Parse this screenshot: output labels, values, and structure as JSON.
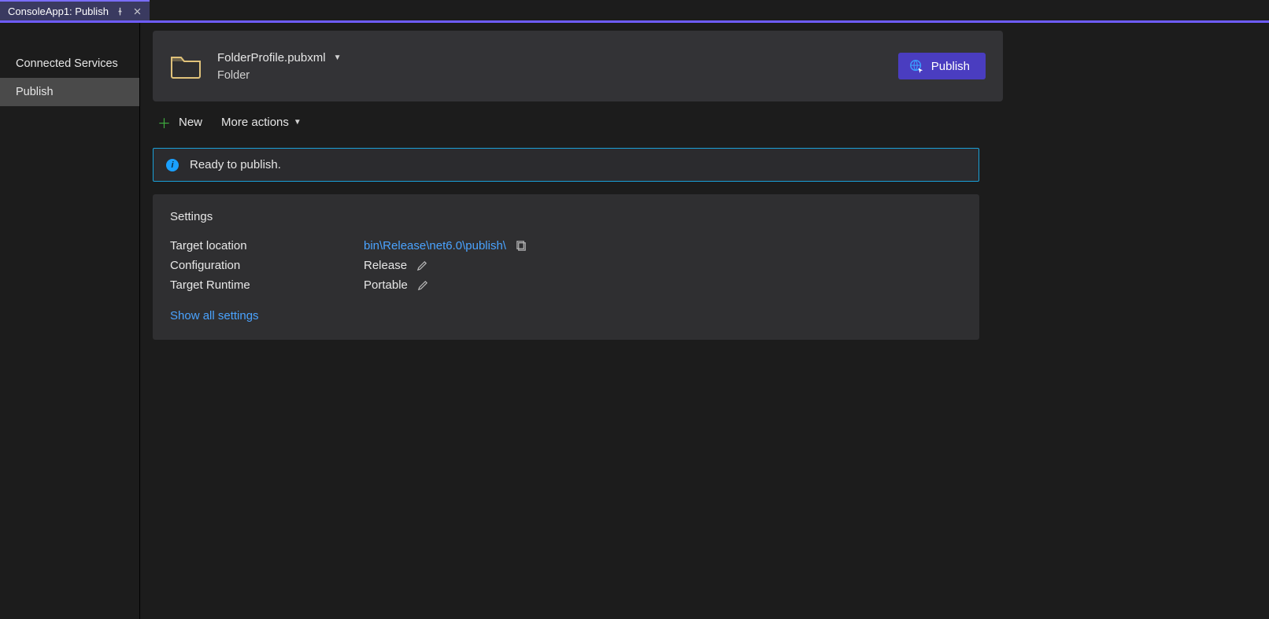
{
  "tab": {
    "title": "ConsoleApp1: Publish"
  },
  "sidebar": {
    "items": [
      {
        "label": "Connected Services",
        "active": false
      },
      {
        "label": "Publish",
        "active": true
      }
    ]
  },
  "header": {
    "profile_name": "FolderProfile.pubxml",
    "profile_type": "Folder",
    "publish_button": "Publish"
  },
  "toolbar": {
    "new_label": "New",
    "more_actions_label": "More actions"
  },
  "status": {
    "message": "Ready to publish."
  },
  "settings": {
    "title": "Settings",
    "rows": [
      {
        "label": "Target location",
        "value": "bin\\Release\\net6.0\\publish\\",
        "link": true,
        "copy": true,
        "edit": false
      },
      {
        "label": "Configuration",
        "value": "Release",
        "link": false,
        "copy": false,
        "edit": true
      },
      {
        "label": "Target Runtime",
        "value": "Portable",
        "link": false,
        "copy": false,
        "edit": true
      }
    ],
    "show_all_label": "Show all settings"
  }
}
